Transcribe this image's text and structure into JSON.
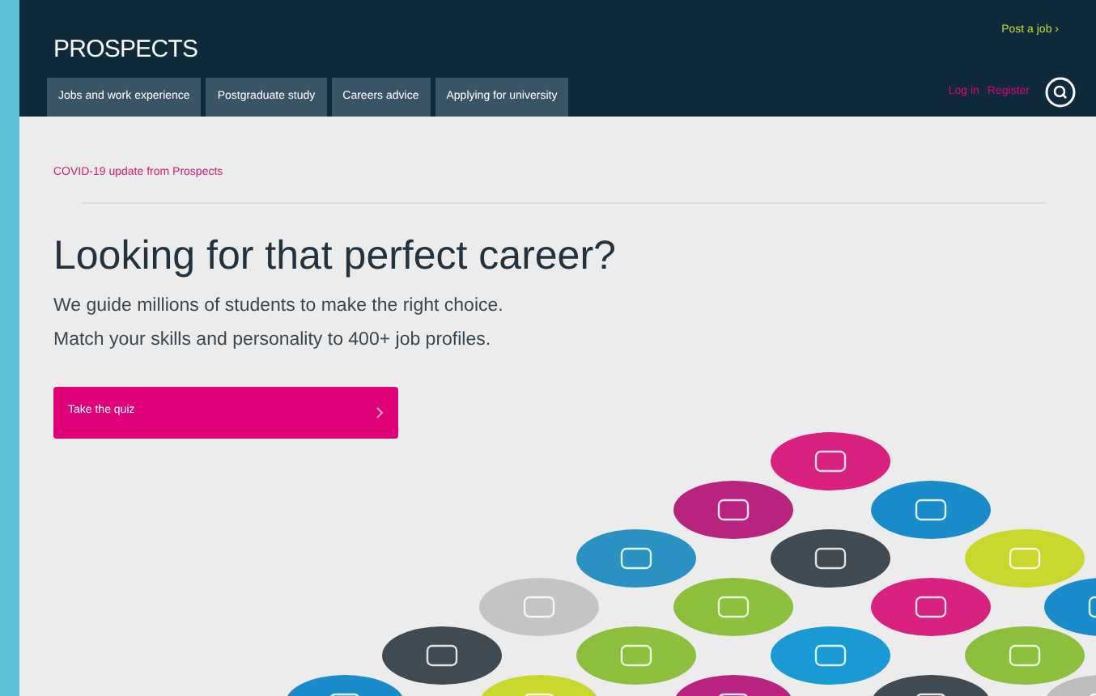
{
  "header": {
    "logo": "PROSPECTS",
    "post_job_link": "Post a job ›"
  },
  "nav": {
    "items": [
      {
        "label": "Jobs and work experience"
      },
      {
        "label": "Postgraduate study"
      },
      {
        "label": "Careers advice"
      },
      {
        "label": "Applying for university"
      }
    ],
    "login": "Log in",
    "register": "Register"
  },
  "notice": "COVID-19 update from Prospects",
  "hero": {
    "title": "Looking for that perfect career?",
    "lines": [
      "We guide millions of students to make the right choice.",
      "Match your skills and personality to 400+ job profiles."
    ],
    "button": "Take the quiz"
  }
}
